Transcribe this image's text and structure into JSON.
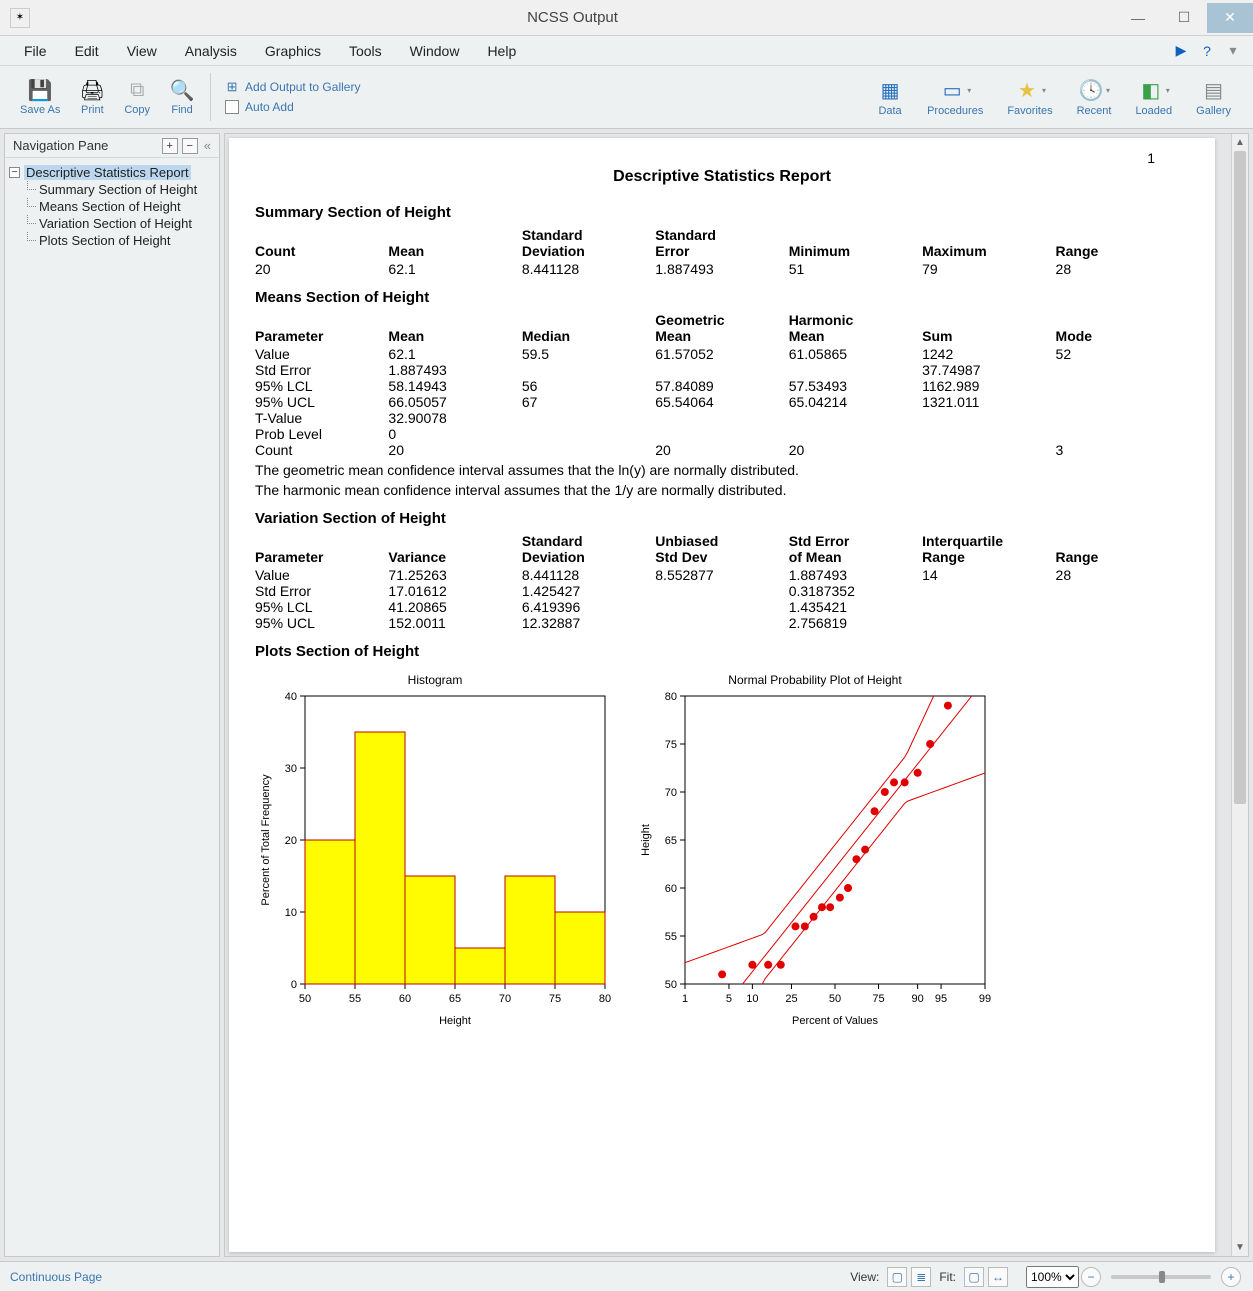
{
  "window": {
    "title": "NCSS Output"
  },
  "menu": [
    "File",
    "Edit",
    "View",
    "Analysis",
    "Graphics",
    "Tools",
    "Window",
    "Help"
  ],
  "toolbar_left": {
    "save_as": "Save As",
    "print": "Print",
    "copy": "Copy",
    "find": "Find",
    "add_to_gallery": "Add Output to Gallery",
    "auto_add": "Auto Add"
  },
  "toolbar_right": [
    "Data",
    "Procedures",
    "Favorites",
    "Recent",
    "Loaded",
    "Gallery"
  ],
  "nav": {
    "title": "Navigation Pane",
    "root": "Descriptive Statistics Report",
    "children": [
      "Summary Section of Height",
      "Means Section of Height",
      "Variation Section of Height",
      "Plots Section of Height"
    ]
  },
  "page_number": "1",
  "report": {
    "title": "Descriptive Statistics Report",
    "summary": {
      "title": "Summary Section of Height",
      "headers": [
        "Count",
        "Mean",
        "Standard Deviation",
        "Standard Error",
        "Minimum",
        "Maximum",
        "Range"
      ],
      "row": [
        "20",
        "62.1",
        "8.441128",
        "1.887493",
        "51",
        "79",
        "28"
      ]
    },
    "means": {
      "title": "Means Section of Height",
      "headers": [
        "Parameter",
        "Mean",
        "Median",
        "Geometric Mean",
        "Harmonic Mean",
        "Sum",
        "Mode"
      ],
      "rows": [
        [
          "Value",
          "62.1",
          "59.5",
          "61.57052",
          "61.05865",
          "1242",
          "52"
        ],
        [
          "Std Error",
          "1.887493",
          "",
          "",
          "",
          "37.74987",
          ""
        ],
        [
          "95% LCL",
          "58.14943",
          "56",
          "57.84089",
          "57.53493",
          "1162.989",
          ""
        ],
        [
          "95% UCL",
          "66.05057",
          "67",
          "65.54064",
          "65.04214",
          "1321.011",
          ""
        ],
        [
          "T-Value",
          "32.90078",
          "",
          "",
          "",
          "",
          ""
        ],
        [
          "Prob Level",
          "0",
          "",
          "",
          "",
          "",
          ""
        ],
        [
          "Count",
          "20",
          "",
          "20",
          "20",
          "",
          "3"
        ]
      ],
      "notes": [
        "The geometric mean confidence interval assumes that the ln(y) are normally distributed.",
        "The harmonic mean confidence interval assumes that the 1/y are normally distributed."
      ]
    },
    "variation": {
      "title": "Variation Section of Height",
      "headers": [
        "Parameter",
        "Variance",
        "Standard Deviation",
        "Unbiased Std Dev",
        "Std Error of Mean",
        "Interquartile Range",
        "Range"
      ],
      "rows": [
        [
          "Value",
          "71.25263",
          "8.441128",
          "8.552877",
          "1.887493",
          "14",
          "28"
        ],
        [
          "Std Error",
          "17.01612",
          "1.425427",
          "",
          "0.3187352",
          "",
          ""
        ],
        [
          "95% LCL",
          "41.20865",
          "6.419396",
          "",
          "1.435421",
          "",
          ""
        ],
        [
          "95% UCL",
          "152.0011",
          "12.32887",
          "",
          "2.756819",
          "",
          ""
        ]
      ]
    },
    "plots_title": "Plots Section of Height"
  },
  "chart_data": [
    {
      "type": "bar",
      "title": "Histogram",
      "xlabel": "Height",
      "ylabel": "Percent of Total Frequency",
      "categories": [
        52.5,
        57.5,
        62.5,
        67.5,
        72.5,
        77.5
      ],
      "values": [
        20,
        35,
        15,
        5,
        15,
        10
      ],
      "xlim": [
        50,
        80
      ],
      "ylim": [
        0,
        40
      ],
      "xticks": [
        50,
        55,
        60,
        65,
        70,
        75,
        80
      ],
      "yticks": [
        0,
        10,
        20,
        30,
        40
      ],
      "bar_color": "#FFFB00",
      "bar_border": "#C00000"
    },
    {
      "type": "scatter",
      "title": "Normal Probability Plot of Height",
      "xlabel": "Percent of Values",
      "ylabel": "Height",
      "xlim": [
        1,
        99
      ],
      "ylim": [
        50,
        80
      ],
      "xticks": [
        1,
        5,
        10,
        25,
        50,
        75,
        90,
        95,
        99
      ],
      "yticks": [
        50,
        55,
        60,
        65,
        70,
        75,
        80
      ],
      "points": [
        {
          "x": 4,
          "y": 51
        },
        {
          "x": 10,
          "y": 52
        },
        {
          "x": 15,
          "y": 52
        },
        {
          "x": 20,
          "y": 52
        },
        {
          "x": 27,
          "y": 56
        },
        {
          "x": 32,
          "y": 56
        },
        {
          "x": 37,
          "y": 57
        },
        {
          "x": 42,
          "y": 58
        },
        {
          "x": 47,
          "y": 58
        },
        {
          "x": 53,
          "y": 59
        },
        {
          "x": 58,
          "y": 60
        },
        {
          "x": 63,
          "y": 63
        },
        {
          "x": 68,
          "y": 64
        },
        {
          "x": 73,
          "y": 68
        },
        {
          "x": 78,
          "y": 70
        },
        {
          "x": 82,
          "y": 71
        },
        {
          "x": 86,
          "y": 71
        },
        {
          "x": 90,
          "y": 72
        },
        {
          "x": 93,
          "y": 75
        },
        {
          "x": 96,
          "y": 79
        }
      ],
      "line_color": "#E00000",
      "point_color": "#E00000"
    }
  ],
  "status": {
    "mode": "Continuous Page",
    "view_label": "View:",
    "fit_label": "Fit:",
    "zoom": "100%"
  }
}
